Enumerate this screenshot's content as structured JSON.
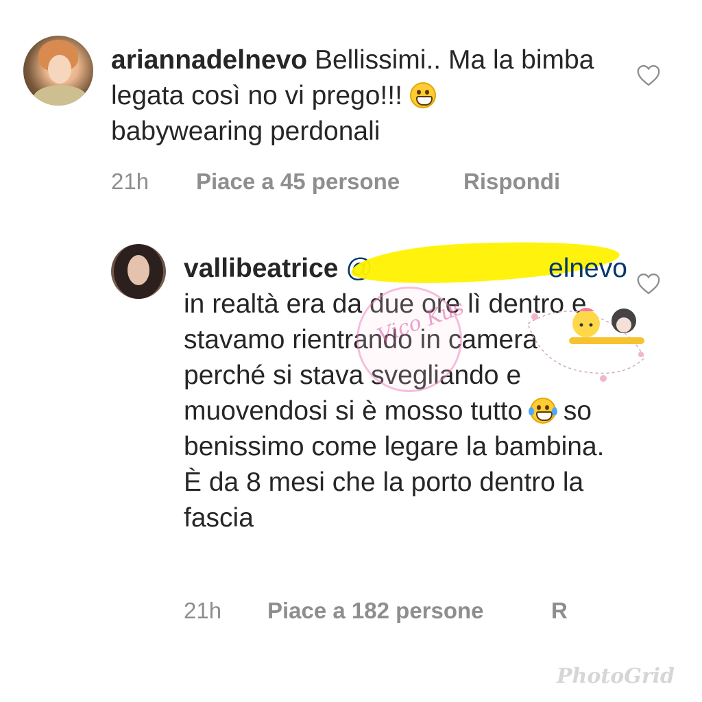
{
  "comments": [
    {
      "username": "ariannadelnevo",
      "text": " Bellissimi.. Ma la bimba legata così no vi prego!!!",
      "emoji": "grinning-face-emoji",
      "text_after": "\nbabywearing perdonali",
      "time": "21h",
      "likes": "Piace a 45 persone",
      "reply": "Rispondi"
    },
    {
      "username": "vallibeatrice",
      "mention_visible": "@",
      "mention_tail": "elnevo",
      "text": "\nin realtà era da due ore lì dentro e stavamo rientrando in camera perché si stava svegliando e muovendosi si è mosso tutto",
      "emoji": "laughing-tears-emoji",
      "text_after": " so benissimo come legare la bambina. È da 8 mesi che la porto dentro la fascia",
      "time": "21h",
      "likes": "Piace a 182 persone",
      "reply": "R"
    }
  ],
  "watermark": {
    "circle_text": "Vico Kus",
    "brand": "PhotoGrid"
  },
  "colors": {
    "text": "#262626",
    "meta": "#8e8e8e",
    "highlight": "#fff200",
    "mention": "#00376b"
  },
  "icons": {
    "like": "heart-outline-icon"
  }
}
